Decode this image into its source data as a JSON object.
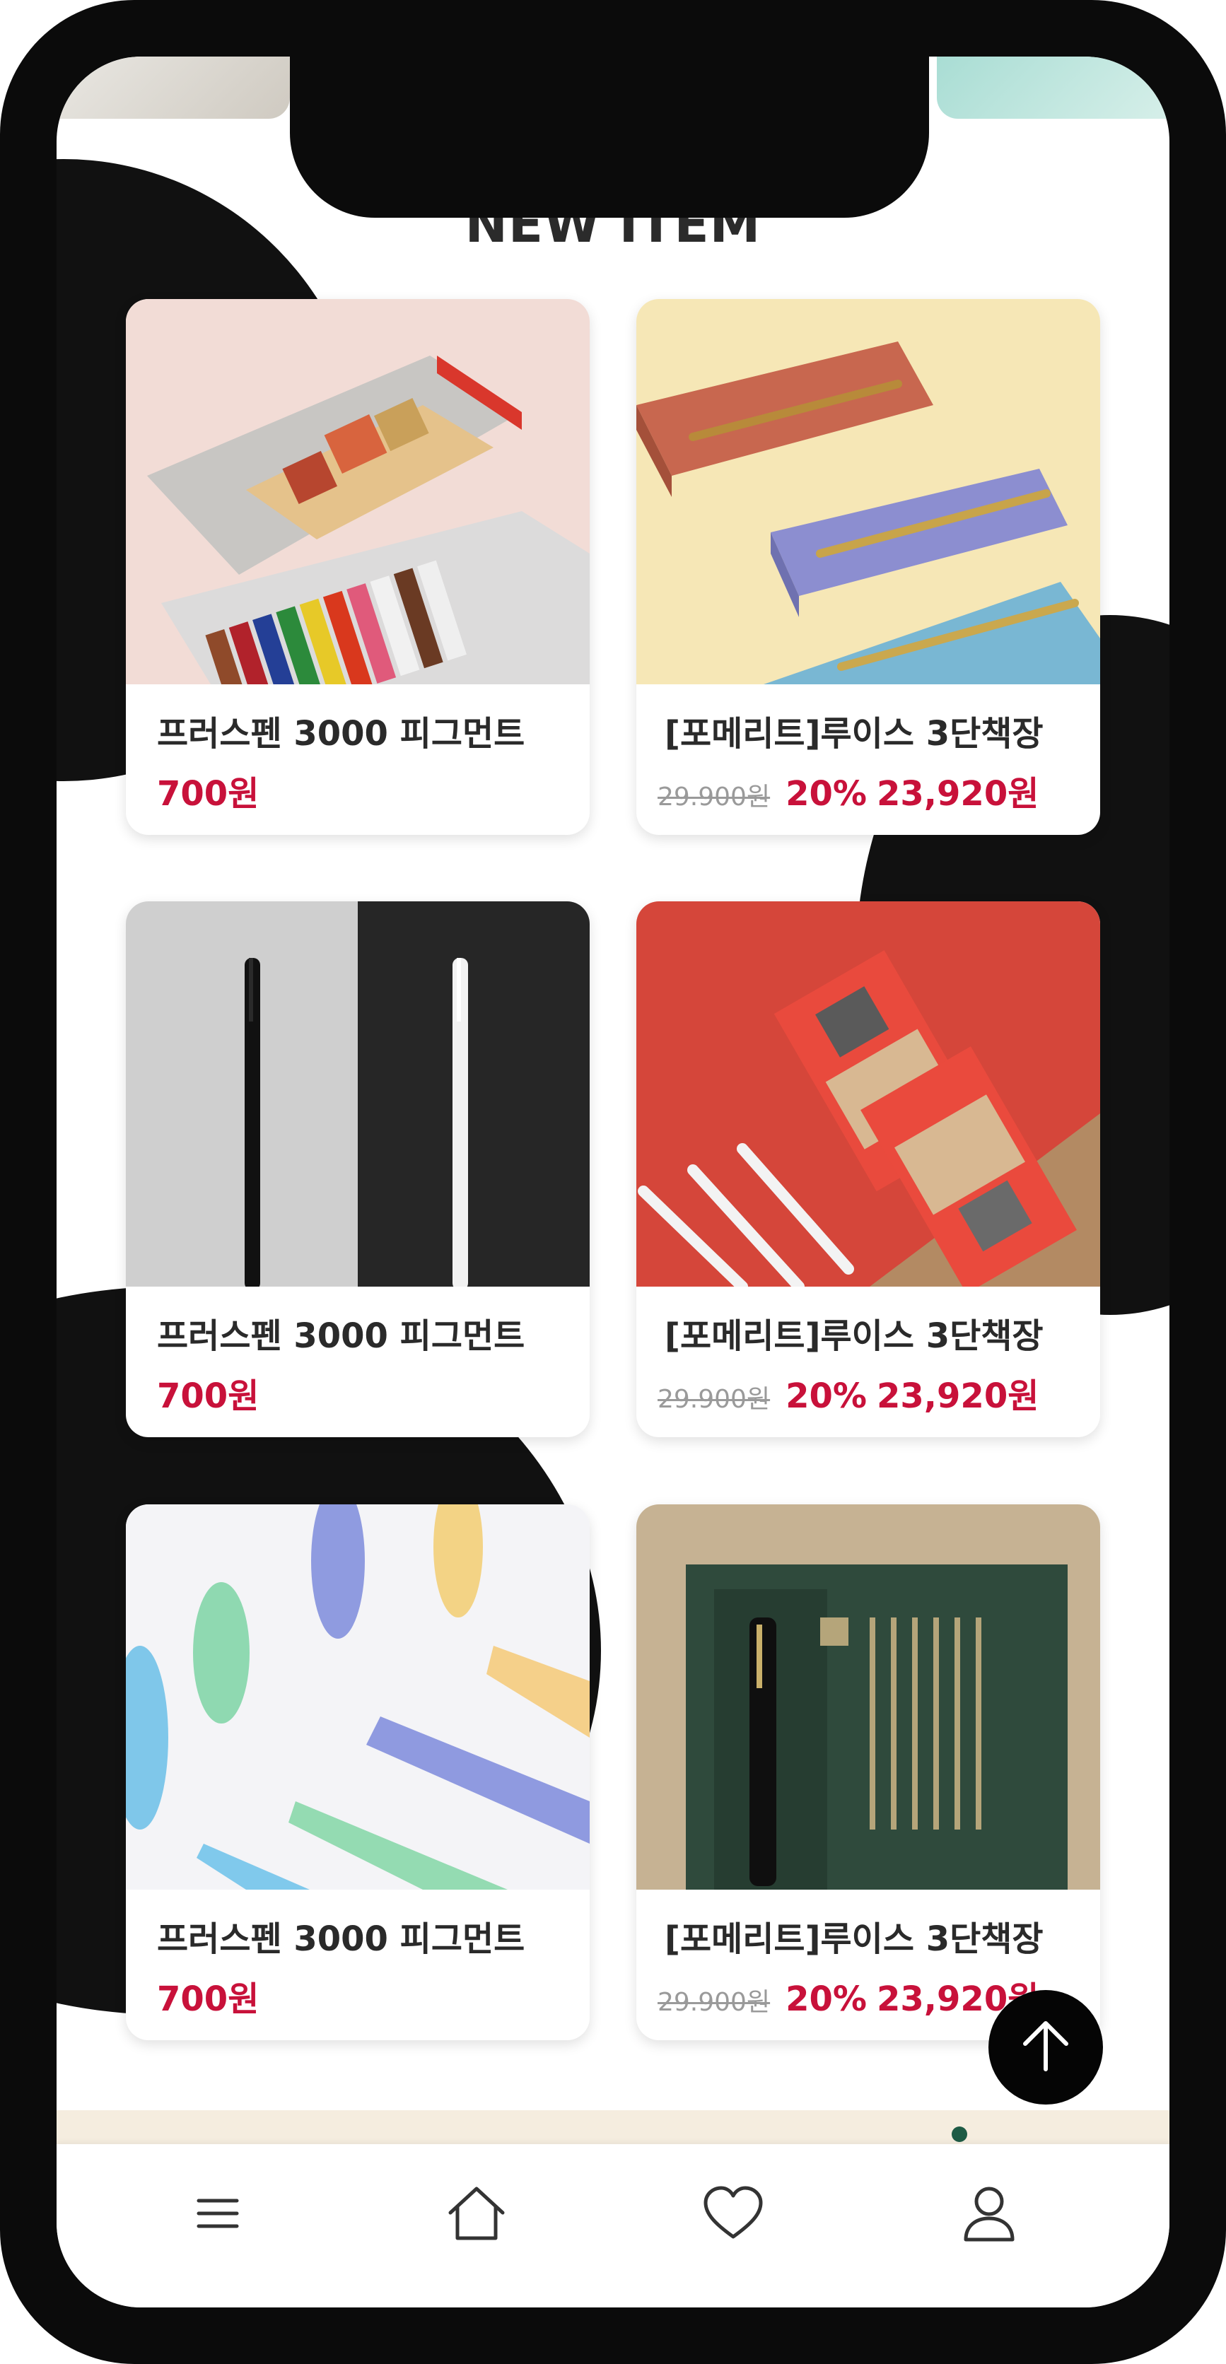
{
  "section": {
    "title": "NEW ITEM"
  },
  "products": [
    {
      "name": "프러스펜 3000 피그먼트",
      "price": "700원"
    },
    {
      "name": "[포메리트]루이스 3단책장",
      "original_price": "29.900원",
      "discount": "20%",
      "sale_price": "23,920원"
    },
    {
      "name": "프러스펜 3000 피그먼트",
      "price": "700원"
    },
    {
      "name": "[포메리트]루이스 3단책장",
      "original_price": "29.900원",
      "discount": "20%",
      "sale_price": "23,920원"
    },
    {
      "name": "프러스펜 3000 피그먼트",
      "price": "700원"
    },
    {
      "name": "[포메리트]루이스 3단책장",
      "original_price": "29.900원",
      "discount": "20%",
      "sale_price": "23,920원"
    }
  ],
  "scroll_top_icon": "arrow-up-icon",
  "bottom_nav": [
    {
      "icon": "menu-icon"
    },
    {
      "icon": "home-icon"
    },
    {
      "icon": "heart-icon"
    },
    {
      "icon": "user-icon"
    }
  ],
  "colors": {
    "price": "#c8113a",
    "frame": "#0b0b0b",
    "text": "#2a2a2a",
    "strike": "#9a9a9a"
  }
}
